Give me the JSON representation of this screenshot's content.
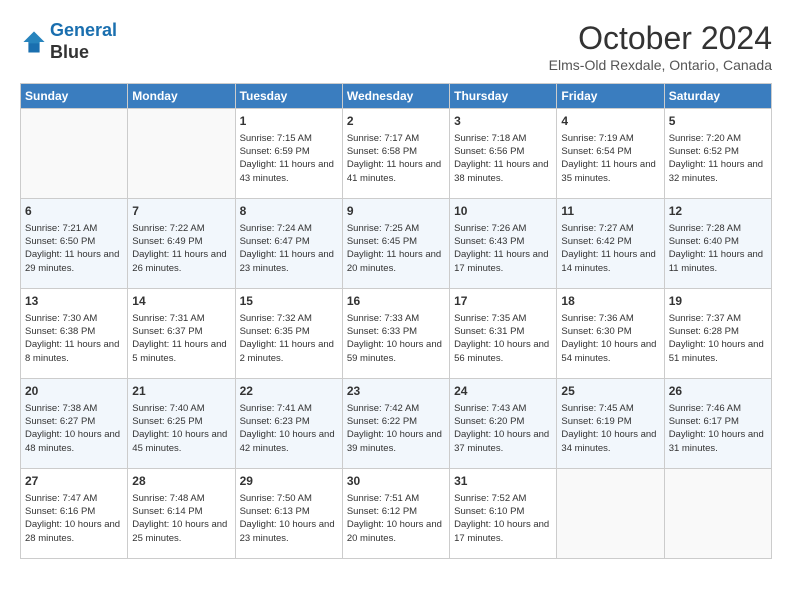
{
  "header": {
    "logo_line1": "General",
    "logo_line2": "Blue",
    "title": "October 2024",
    "subtitle": "Elms-Old Rexdale, Ontario, Canada"
  },
  "days_of_week": [
    "Sunday",
    "Monday",
    "Tuesday",
    "Wednesday",
    "Thursday",
    "Friday",
    "Saturday"
  ],
  "weeks": [
    [
      {
        "day": "",
        "content": ""
      },
      {
        "day": "",
        "content": ""
      },
      {
        "day": "1",
        "content": "Sunrise: 7:15 AM\nSunset: 6:59 PM\nDaylight: 11 hours and 43 minutes."
      },
      {
        "day": "2",
        "content": "Sunrise: 7:17 AM\nSunset: 6:58 PM\nDaylight: 11 hours and 41 minutes."
      },
      {
        "day": "3",
        "content": "Sunrise: 7:18 AM\nSunset: 6:56 PM\nDaylight: 11 hours and 38 minutes."
      },
      {
        "day": "4",
        "content": "Sunrise: 7:19 AM\nSunset: 6:54 PM\nDaylight: 11 hours and 35 minutes."
      },
      {
        "day": "5",
        "content": "Sunrise: 7:20 AM\nSunset: 6:52 PM\nDaylight: 11 hours and 32 minutes."
      }
    ],
    [
      {
        "day": "6",
        "content": "Sunrise: 7:21 AM\nSunset: 6:50 PM\nDaylight: 11 hours and 29 minutes."
      },
      {
        "day": "7",
        "content": "Sunrise: 7:22 AM\nSunset: 6:49 PM\nDaylight: 11 hours and 26 minutes."
      },
      {
        "day": "8",
        "content": "Sunrise: 7:24 AM\nSunset: 6:47 PM\nDaylight: 11 hours and 23 minutes."
      },
      {
        "day": "9",
        "content": "Sunrise: 7:25 AM\nSunset: 6:45 PM\nDaylight: 11 hours and 20 minutes."
      },
      {
        "day": "10",
        "content": "Sunrise: 7:26 AM\nSunset: 6:43 PM\nDaylight: 11 hours and 17 minutes."
      },
      {
        "day": "11",
        "content": "Sunrise: 7:27 AM\nSunset: 6:42 PM\nDaylight: 11 hours and 14 minutes."
      },
      {
        "day": "12",
        "content": "Sunrise: 7:28 AM\nSunset: 6:40 PM\nDaylight: 11 hours and 11 minutes."
      }
    ],
    [
      {
        "day": "13",
        "content": "Sunrise: 7:30 AM\nSunset: 6:38 PM\nDaylight: 11 hours and 8 minutes."
      },
      {
        "day": "14",
        "content": "Sunrise: 7:31 AM\nSunset: 6:37 PM\nDaylight: 11 hours and 5 minutes."
      },
      {
        "day": "15",
        "content": "Sunrise: 7:32 AM\nSunset: 6:35 PM\nDaylight: 11 hours and 2 minutes."
      },
      {
        "day": "16",
        "content": "Sunrise: 7:33 AM\nSunset: 6:33 PM\nDaylight: 10 hours and 59 minutes."
      },
      {
        "day": "17",
        "content": "Sunrise: 7:35 AM\nSunset: 6:31 PM\nDaylight: 10 hours and 56 minutes."
      },
      {
        "day": "18",
        "content": "Sunrise: 7:36 AM\nSunset: 6:30 PM\nDaylight: 10 hours and 54 minutes."
      },
      {
        "day": "19",
        "content": "Sunrise: 7:37 AM\nSunset: 6:28 PM\nDaylight: 10 hours and 51 minutes."
      }
    ],
    [
      {
        "day": "20",
        "content": "Sunrise: 7:38 AM\nSunset: 6:27 PM\nDaylight: 10 hours and 48 minutes."
      },
      {
        "day": "21",
        "content": "Sunrise: 7:40 AM\nSunset: 6:25 PM\nDaylight: 10 hours and 45 minutes."
      },
      {
        "day": "22",
        "content": "Sunrise: 7:41 AM\nSunset: 6:23 PM\nDaylight: 10 hours and 42 minutes."
      },
      {
        "day": "23",
        "content": "Sunrise: 7:42 AM\nSunset: 6:22 PM\nDaylight: 10 hours and 39 minutes."
      },
      {
        "day": "24",
        "content": "Sunrise: 7:43 AM\nSunset: 6:20 PM\nDaylight: 10 hours and 37 minutes."
      },
      {
        "day": "25",
        "content": "Sunrise: 7:45 AM\nSunset: 6:19 PM\nDaylight: 10 hours and 34 minutes."
      },
      {
        "day": "26",
        "content": "Sunrise: 7:46 AM\nSunset: 6:17 PM\nDaylight: 10 hours and 31 minutes."
      }
    ],
    [
      {
        "day": "27",
        "content": "Sunrise: 7:47 AM\nSunset: 6:16 PM\nDaylight: 10 hours and 28 minutes."
      },
      {
        "day": "28",
        "content": "Sunrise: 7:48 AM\nSunset: 6:14 PM\nDaylight: 10 hours and 25 minutes."
      },
      {
        "day": "29",
        "content": "Sunrise: 7:50 AM\nSunset: 6:13 PM\nDaylight: 10 hours and 23 minutes."
      },
      {
        "day": "30",
        "content": "Sunrise: 7:51 AM\nSunset: 6:12 PM\nDaylight: 10 hours and 20 minutes."
      },
      {
        "day": "31",
        "content": "Sunrise: 7:52 AM\nSunset: 6:10 PM\nDaylight: 10 hours and 17 minutes."
      },
      {
        "day": "",
        "content": ""
      },
      {
        "day": "",
        "content": ""
      }
    ]
  ]
}
